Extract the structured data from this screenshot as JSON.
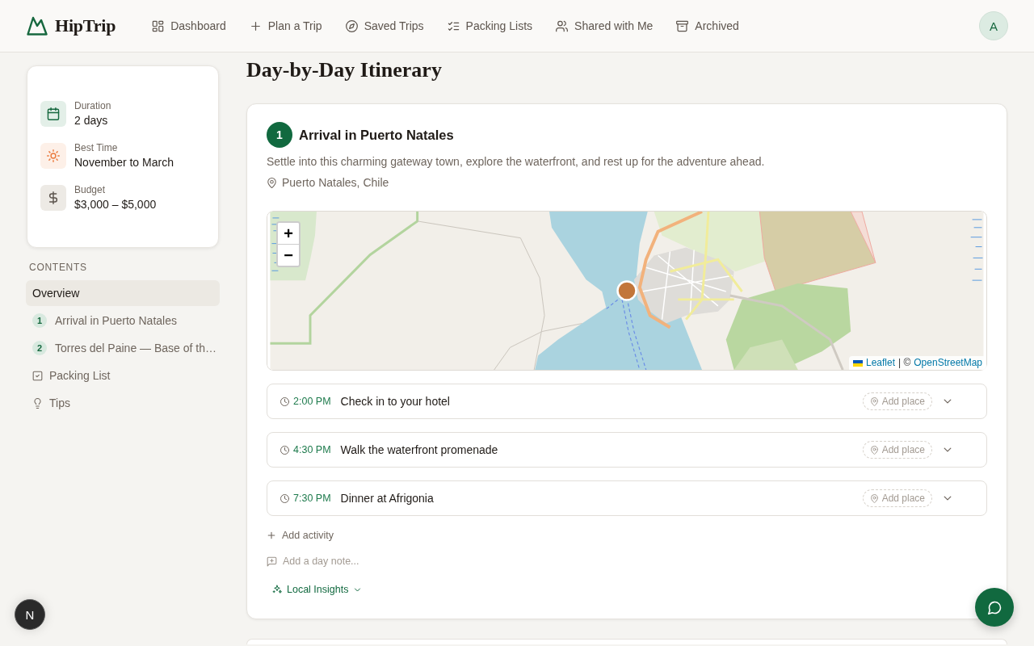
{
  "header": {
    "logo": "HipTrip",
    "nav": [
      {
        "label": "Dashboard",
        "selected": false
      },
      {
        "label": "Plan a Trip",
        "selected": false
      },
      {
        "label": "Saved Trips",
        "selected": false
      },
      {
        "label": "Packing Lists",
        "selected": false
      },
      {
        "label": "Shared with Me",
        "selected": false
      },
      {
        "label": "Archived",
        "selected": false
      }
    ],
    "avatar": "A"
  },
  "sidebar": {
    "facts": [
      {
        "label": "Duration",
        "value": "2 days"
      },
      {
        "label": "Best Time",
        "value": "November to March"
      },
      {
        "label": "Budget",
        "value": "$3,000 – $5,000"
      }
    ],
    "contents": {
      "heading": "CONTENTS",
      "items": [
        {
          "kind": "plain",
          "label": "Overview",
          "selected": true
        },
        {
          "kind": "day",
          "number": "1",
          "label": "Arrival in Puerto Natales",
          "selected": false
        },
        {
          "kind": "day",
          "number": "2",
          "label": "Torres del Paine — Base of th…",
          "selected": false
        },
        {
          "kind": "checklist",
          "label": "Packing List",
          "selected": false
        },
        {
          "kind": "tip",
          "label": "Tips",
          "selected": false
        }
      ]
    }
  },
  "itinerary": {
    "title": "Day-by-Day Itinerary",
    "days": [
      {
        "number": "1",
        "title": "Arrival in Puerto Natales",
        "description": "Settle into this charming gateway town, explore the waterfront, and rest up for the adventure ahead.",
        "location": "Puerto Natales, Chile",
        "map": {
          "zoom_in": "+",
          "zoom_out": "−",
          "attribution": {
            "leaflet": "Leaflet",
            "separator": "| ©",
            "osm": "OpenStreetMap"
          }
        },
        "activities": [
          {
            "time": "2:00 PM",
            "title": "Check in to your hotel",
            "add_place": "Add place",
            "expanded": false
          },
          {
            "time": "4:30 PM",
            "title": "Walk the waterfront promenade",
            "add_place": "Add place",
            "expanded": false
          },
          {
            "time": "7:30 PM",
            "title": "Dinner at Afrigonia",
            "add_place": "Add place",
            "expanded": false
          }
        ],
        "add_activity": "Add activity",
        "note": {
          "placeholder": "Add a day note..."
        },
        "insights": {
          "label": "Local Insights",
          "expanded": false
        }
      }
    ]
  },
  "dev_badge": "N"
}
